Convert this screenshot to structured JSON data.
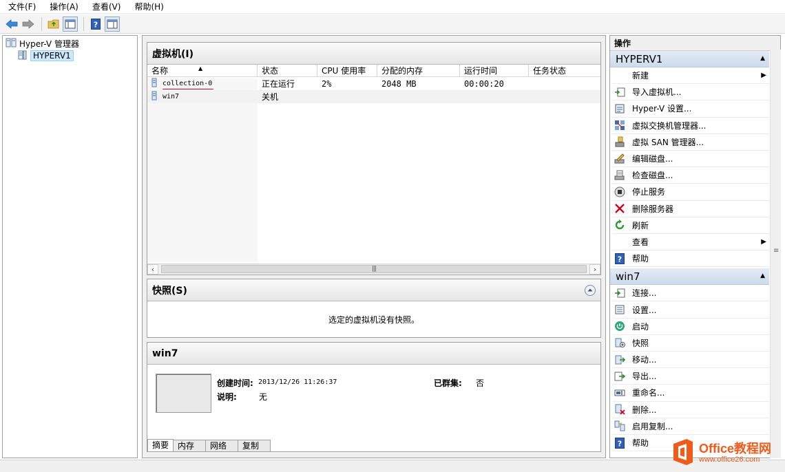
{
  "menubar": [
    "文件(F)",
    "操作(A)",
    "查看(V)",
    "帮助(H)"
  ],
  "tree": {
    "root": "Hyper-V 管理器",
    "child": "HYPERV1"
  },
  "vm_panel": {
    "title": "虚拟机(I)",
    "columns": [
      "名称",
      "状态",
      "CPU 使用率",
      "分配的内存",
      "运行时间",
      "任务状态"
    ],
    "rows": [
      {
        "name": "collection-0",
        "status": "正在运行",
        "cpu": "2%",
        "memory": "2048 MB",
        "uptime": "00:00:20",
        "task": ""
      },
      {
        "name": "win7",
        "status": "关机",
        "cpu": "",
        "memory": "",
        "uptime": "",
        "task": ""
      }
    ]
  },
  "snapshot_panel": {
    "title": "快照(S)",
    "empty_text": "选定的虚拟机没有快照。"
  },
  "detail_panel": {
    "title": "win7",
    "created_label": "创建时间:",
    "created_value": "2013/12/26 11:26:37",
    "desc_label": "说明:",
    "desc_value": "无",
    "cluster_label": "已群集:",
    "cluster_value": "否",
    "tabs": [
      "摘要",
      "内存",
      "网络",
      "复制"
    ]
  },
  "actions": {
    "title": "操作",
    "host_section": "HYPERV1",
    "host_items": [
      {
        "label": "新建",
        "icon": "none",
        "submenu": true
      },
      {
        "label": "导入虚拟机...",
        "icon": "import-icon"
      },
      {
        "label": "Hyper-V 设置...",
        "icon": "settings-icon"
      },
      {
        "label": "虚拟交换机管理器...",
        "icon": "switch-icon"
      },
      {
        "label": "虚拟 SAN 管理器...",
        "icon": "san-icon"
      },
      {
        "label": "编辑磁盘...",
        "icon": "edit-disk-icon"
      },
      {
        "label": "检查磁盘...",
        "icon": "inspect-disk-icon"
      },
      {
        "label": "停止服务",
        "icon": "stop-icon"
      },
      {
        "label": "删除服务器",
        "icon": "delete-x-icon"
      },
      {
        "label": "刷新",
        "icon": "refresh-icon"
      },
      {
        "label": "查看",
        "icon": "none",
        "submenu": true
      },
      {
        "label": "帮助",
        "icon": "help-icon"
      }
    ],
    "vm_section": "win7",
    "vm_items": [
      {
        "label": "连接...",
        "icon": "connect-icon"
      },
      {
        "label": "设置...",
        "icon": "vm-settings-icon"
      },
      {
        "label": "启动",
        "icon": "power-icon"
      },
      {
        "label": "快照",
        "icon": "snapshot-icon"
      },
      {
        "label": "移动...",
        "icon": "move-icon"
      },
      {
        "label": "导出...",
        "icon": "export-icon"
      },
      {
        "label": "重命名...",
        "icon": "rename-icon"
      },
      {
        "label": "删除...",
        "icon": "delete-icon"
      },
      {
        "label": "启用复制...",
        "icon": "replication-icon"
      },
      {
        "label": "帮助",
        "icon": "help-icon"
      }
    ]
  },
  "watermark": {
    "line1": "Office教程网",
    "line2": "www.office26.com"
  },
  "colors": {
    "selection": "#cce8ff",
    "section_header": "#cddbeb",
    "annotation_underline": "#d0021b",
    "logo_orange": "#f05a1a"
  }
}
